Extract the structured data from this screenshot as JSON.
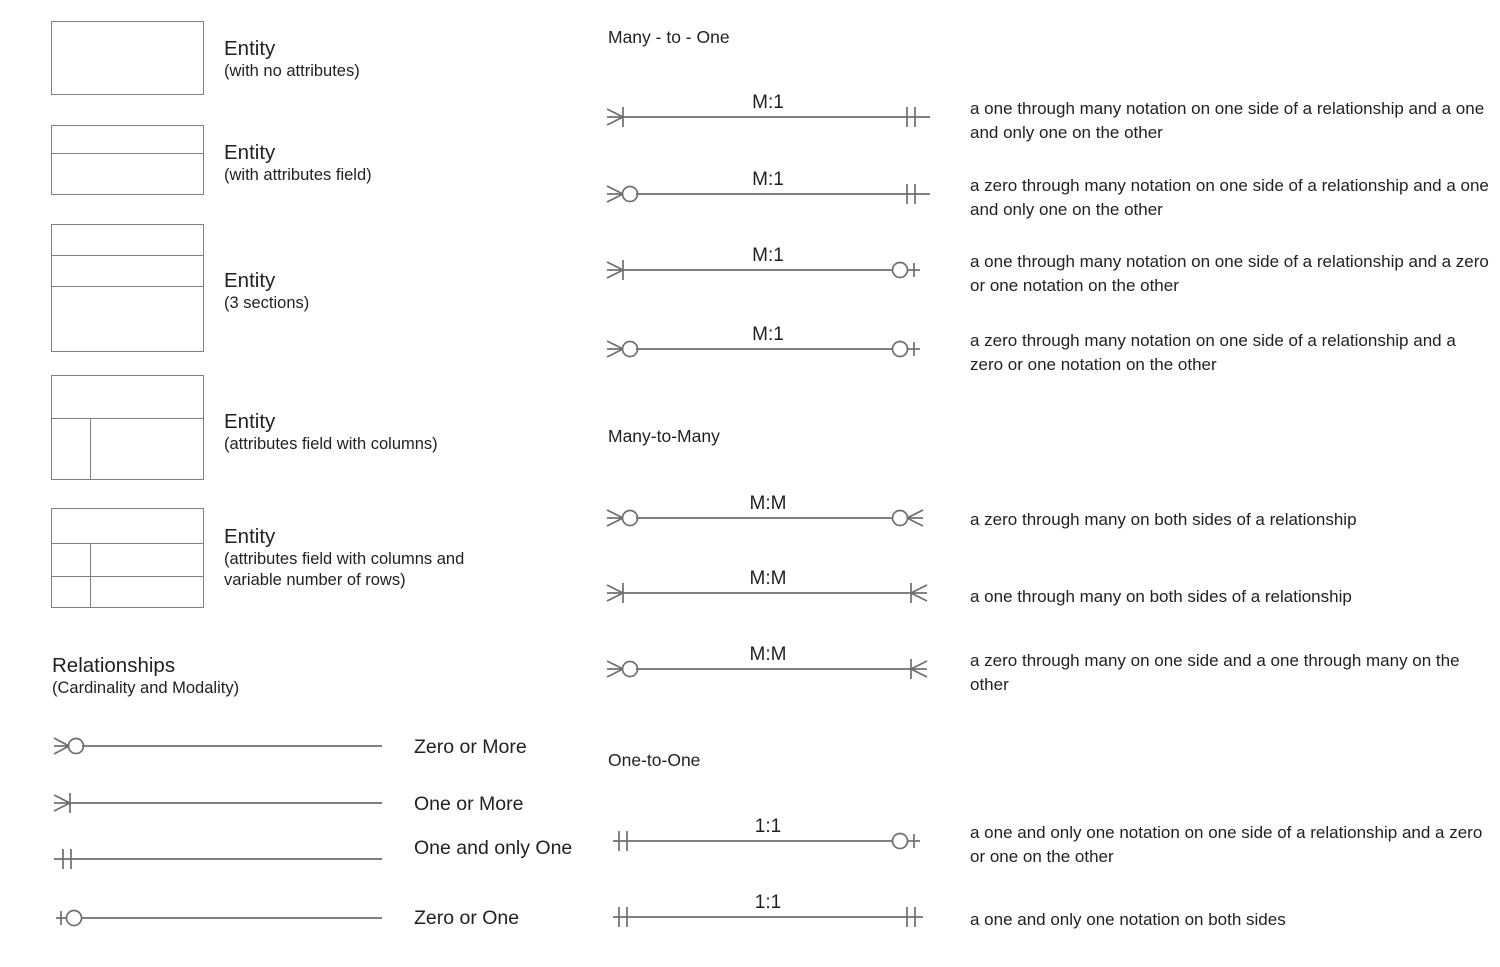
{
  "entities": [
    {
      "name": "entity-no-attributes",
      "title": "Entity",
      "subtitle": "(with no attributes)"
    },
    {
      "name": "entity-attributes-field",
      "title": "Entity",
      "subtitle": "(with attributes field)"
    },
    {
      "name": "entity-3-sections",
      "title": "Entity",
      "subtitle": "(3 sections)"
    },
    {
      "name": "entity-attributes-columns",
      "title": "Entity",
      "subtitle": "(attributes field with columns)"
    },
    {
      "name": "entity-attributes-columns-rows",
      "title": "Entity",
      "subtitle": "(attributes field with columns and variable number of rows)"
    }
  ],
  "relationships_section": {
    "heading": "Relationships",
    "subheading": "(Cardinality and Modality)",
    "items": [
      {
        "icon": "zero-or-more-line",
        "label": "Zero or More"
      },
      {
        "icon": "one-or-more-line",
        "label": "One or More"
      },
      {
        "icon": "one-and-only-one-line",
        "label": "One and only One"
      },
      {
        "icon": "zero-or-one-line",
        "label": "Zero or One"
      }
    ]
  },
  "groups": [
    {
      "name": "many-to-one",
      "heading": "Many - to - One",
      "rows": [
        {
          "cardinality": "M:1",
          "left": "one-or-more",
          "right": "one-and-only-one",
          "description": "a one through many notation on one side of a relationship and a one and only one on the other"
        },
        {
          "cardinality": "M:1",
          "left": "zero-or-more",
          "right": "one-and-only-one",
          "description": "a zero through many notation on one side of a relationship and a one and only one on the other"
        },
        {
          "cardinality": "M:1",
          "left": "one-or-more",
          "right": "zero-or-one",
          "description": "a one through many notation on one side of a relationship and a zero or one notation on the other"
        },
        {
          "cardinality": "M:1",
          "left": "zero-or-more",
          "right": "zero-or-one",
          "description": "a zero through many notation on one side of a relationship and a zero or one notation on the other"
        }
      ]
    },
    {
      "name": "many-to-many",
      "heading": "Many-to-Many",
      "rows": [
        {
          "cardinality": "M:M",
          "left": "zero-or-more",
          "right": "zero-or-more",
          "description": "a zero through many on both sides of a relationship"
        },
        {
          "cardinality": "M:M",
          "left": "one-or-more",
          "right": "one-or-more",
          "description": "a one through many on both sides of a relationship"
        },
        {
          "cardinality": "M:M",
          "left": "zero-or-more",
          "right": "one-or-more",
          "description": "a zero through many on one side and a one through many on the other"
        }
      ]
    },
    {
      "name": "one-to-one",
      "heading": "One-to-One",
      "rows": [
        {
          "cardinality": "1:1",
          "left": "one-and-only-one",
          "right": "zero-or-one",
          "description": "a one and only one notation on one side of a relationship and a zero or one on the other"
        },
        {
          "cardinality": "1:1",
          "left": "one-and-only-one",
          "right": "one-and-only-one",
          "description": "a one and only one notation on both sides"
        }
      ]
    }
  ],
  "colors": {
    "line": "#6d6e71",
    "box_border": "#808080",
    "text": "#231f20",
    "background": "#ffffff"
  }
}
